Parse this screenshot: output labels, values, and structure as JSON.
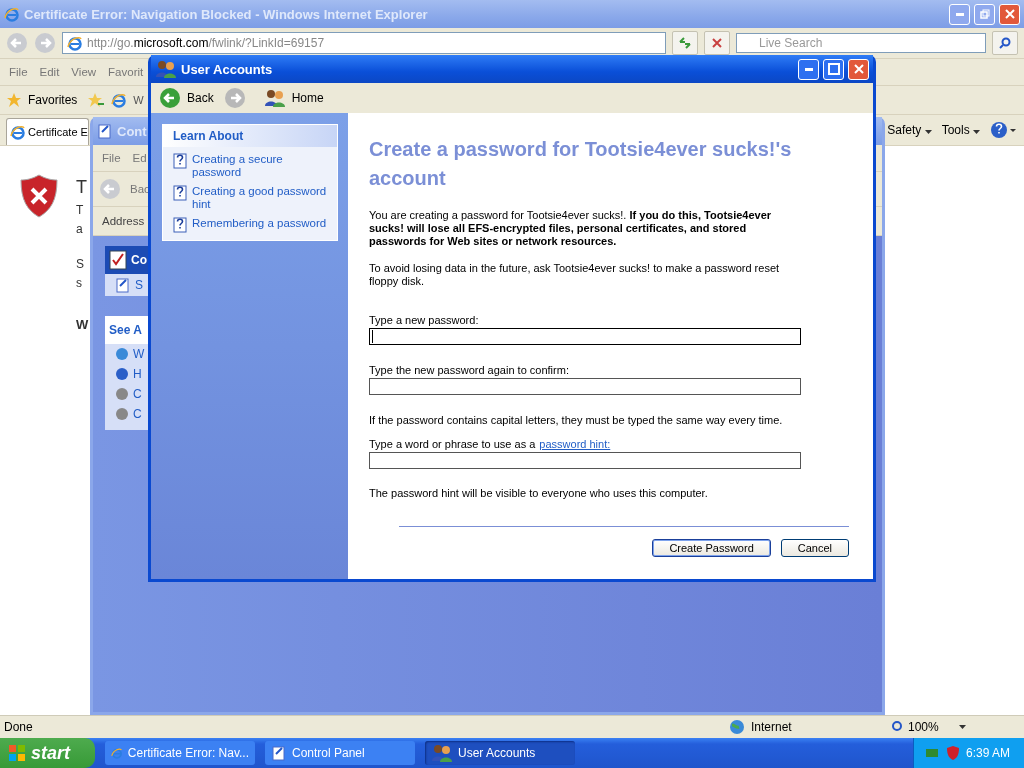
{
  "browser": {
    "title": "Certificate Error: Navigation Blocked - Windows Internet Explorer",
    "address": {
      "prefix": "http://go.",
      "domain": "microsoft.com",
      "path": "/fwlink/?LinkId=69157"
    },
    "search": {
      "placeholder": "Live Search"
    },
    "menu": [
      "File",
      "Edit",
      "View",
      "Favorit"
    ],
    "favorites": "Favorites",
    "favorite_cut": "W",
    "tab": "Certificate E",
    "commands": [
      "Safety",
      "Tools"
    ],
    "page_fragments": [
      {
        "kind": "title",
        "text": "T"
      },
      {
        "kind": "line",
        "text": "T"
      },
      {
        "kind": "line",
        "text": "a"
      },
      {
        "kind": "gap",
        "text": "S"
      },
      {
        "kind": "line",
        "text": "s"
      },
      {
        "kind": "heading",
        "text": "W"
      }
    ],
    "status": "Done",
    "zone": "Internet",
    "zoom": "100%"
  },
  "control_panel": {
    "title": "Cont",
    "menu": [
      "File",
      "Ed"
    ],
    "back": "Bac",
    "address_label": "Address",
    "task_title": "Co",
    "task_item": "S",
    "see_also_title": "See A",
    "see_also_items": [
      "W",
      "H",
      "C",
      "C"
    ]
  },
  "dialog": {
    "title": "User Accounts",
    "back": "Back",
    "home": "Home",
    "learn_about": {
      "title": "Learn About",
      "items": [
        "Creating a secure password",
        "Creating a good password hint",
        "Remembering a password"
      ]
    },
    "heading": "Create a password for Tootsie4ever sucks!'s account",
    "paragraphs": [
      "You are creating a password for Tootsie4ever sucks!. **If you do this, Tootsie4ever sucks! will lose all EFS-encrypted files, personal certificates, and stored passwords for Web sites or network resources.**",
      "To avoid losing data in the future, ask Tootsie4ever sucks! to make a password reset floppy disk."
    ],
    "fields": [
      {
        "label": "Type a new password:",
        "focused": true
      },
      {
        "label": "Type the new password again to confirm:",
        "focused": false
      },
      {
        "label": "Type a word or phrase to use as a",
        "link": "password hint:",
        "note_before": "If the password contains capital letters, they must be typed the same way every time.",
        "focused": false
      }
    ],
    "hint_note": "The password hint will be visible to everyone who uses this computer.",
    "buttons": [
      {
        "label": "Create Password",
        "default": true
      },
      {
        "label": "Cancel",
        "default": false
      }
    ]
  },
  "taskbar": {
    "start": "start",
    "items": [
      {
        "label": "Certificate Error: Nav...",
        "selected": false,
        "kind": "ie"
      },
      {
        "label": "Control Panel",
        "selected": false,
        "kind": "panel"
      },
      {
        "label": "User Accounts",
        "selected": true,
        "kind": "users"
      }
    ],
    "clock": "6:39 AM"
  }
}
